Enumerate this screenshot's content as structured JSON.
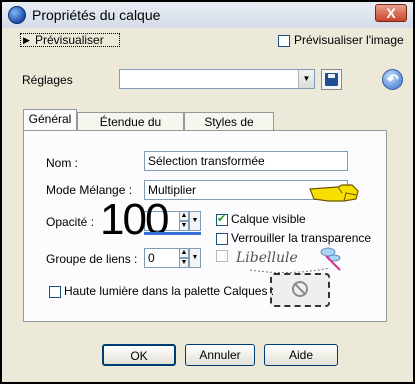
{
  "window": {
    "title": "Propriétés du calque",
    "close_label": "X"
  },
  "preview": {
    "collapse_label": "Prévisualiser",
    "preview_image_label": "Prévisualiser l'image"
  },
  "settings": {
    "label": "Réglages",
    "value": ""
  },
  "tabs": [
    {
      "label": "Général"
    },
    {
      "label": "Étendue du mélange"
    },
    {
      "label": "Styles de calque"
    }
  ],
  "general": {
    "name_label": "Nom :",
    "name_value": "Sélection transformée",
    "blend_label": "Mode Mélange :",
    "blend_value": "Multiplier",
    "opacity_label": "Opacité :",
    "opacity_value": "100",
    "layer_visible_label": "Calque visible",
    "layer_visible_checked": true,
    "lock_transparency_label": "Verrouiller la transparence",
    "lock_transparency_checked": false,
    "link_group_label": "Groupe de liens :",
    "link_group_value": "0",
    "highlight_label": "Haute lumière dans la palette Calques :",
    "highlight_checked": false
  },
  "watermark": {
    "text": "Libellule"
  },
  "buttons": {
    "ok": "OK",
    "cancel": "Annuler",
    "help": "Aide"
  }
}
